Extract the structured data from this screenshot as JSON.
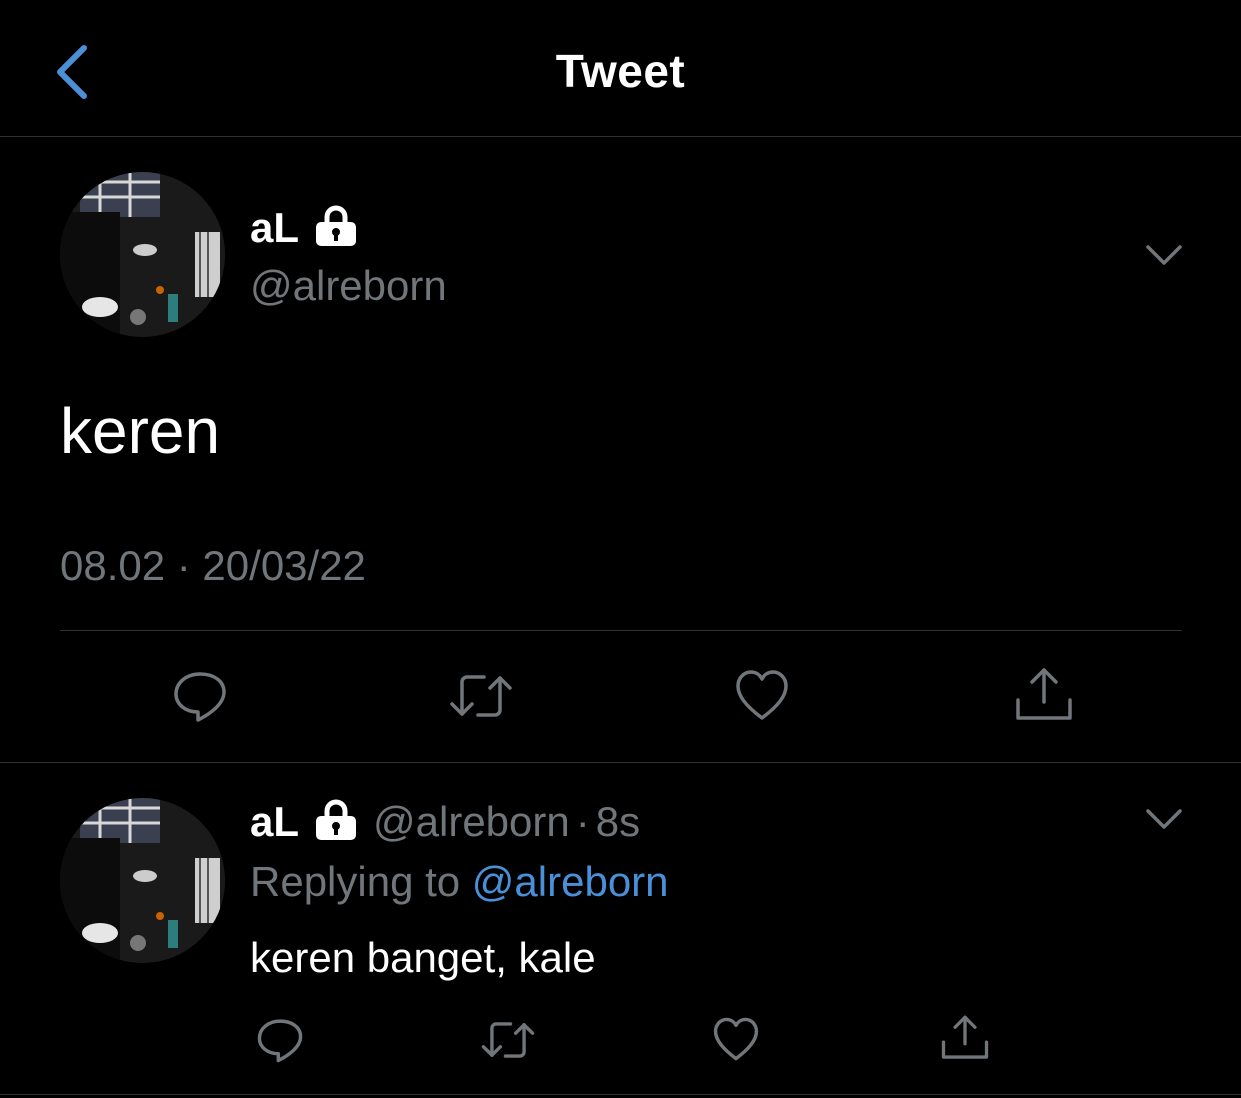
{
  "header": {
    "title": "Tweet",
    "back_icon": "chevron-left-icon"
  },
  "colors": {
    "background": "#000000",
    "accent": "#4a90d9",
    "secondary_text": "#71767b",
    "divider": "#2f3336"
  },
  "main_tweet": {
    "display_name": "aL",
    "protected_icon": "lock-icon",
    "handle": "@alreborn",
    "text": "keren",
    "timestamp": "08.02 · 20/03/22",
    "actions": [
      "reply-icon",
      "retweet-icon",
      "like-icon",
      "share-icon"
    ]
  },
  "reply": {
    "display_name": "aL",
    "protected_icon": "lock-icon",
    "handle": "@alreborn",
    "separator": "·",
    "time": "8s",
    "replying_prefix": "Replying to",
    "replying_handle": "@alreborn",
    "text": "keren banget, kale",
    "actions": [
      "reply-icon",
      "retweet-icon",
      "like-icon",
      "share-icon"
    ]
  }
}
